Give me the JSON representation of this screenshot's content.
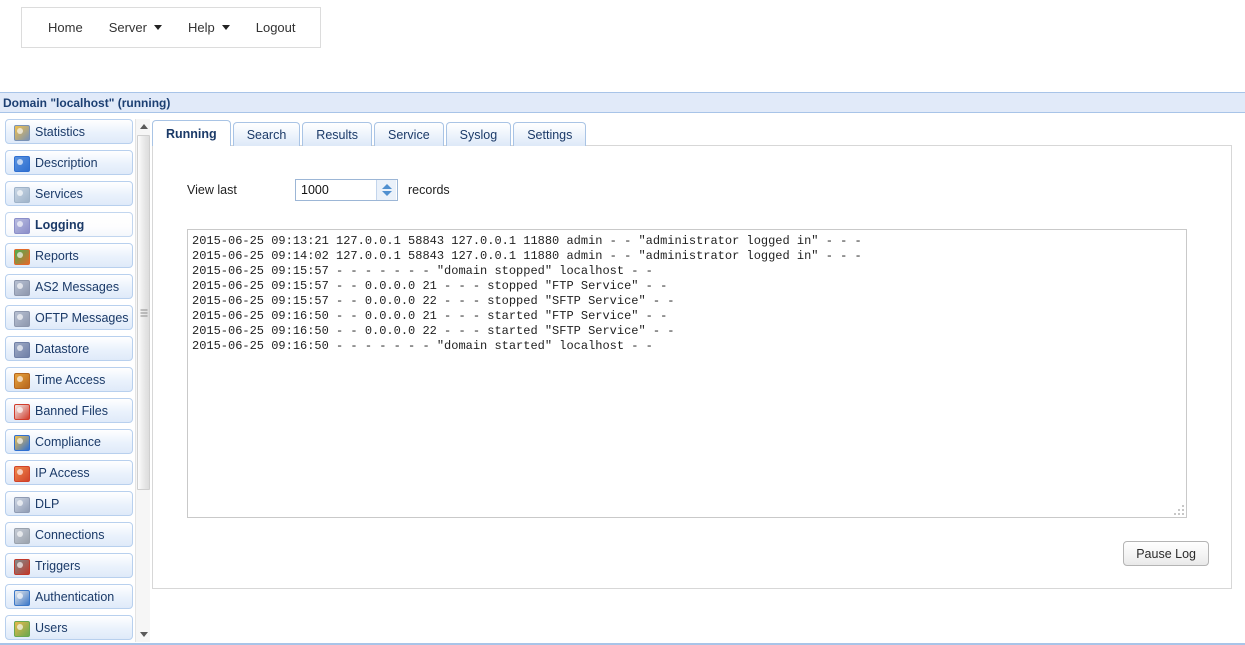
{
  "topnav": {
    "items": [
      {
        "label": "Home",
        "icon": "",
        "has_caret": false
      },
      {
        "label": "Server",
        "icon": "chevron-down-icon",
        "has_caret": true
      },
      {
        "label": "Help",
        "icon": "chevron-down-icon",
        "has_caret": true
      },
      {
        "label": "Logout",
        "icon": "",
        "has_caret": false
      }
    ]
  },
  "domain_bar": {
    "title": "Domain \"localhost\" (running)"
  },
  "sidebar": {
    "scrollbar": {
      "up_icon": "triangle-up-icon",
      "down_icon": "triangle-down-icon",
      "grip_icon": "grip-lines-icon"
    },
    "items": [
      {
        "label": "Statistics",
        "icon": "statistics-icon",
        "active": false,
        "c1": "#7a92b5",
        "c2": "#f2c14b"
      },
      {
        "label": "Description",
        "icon": "description-icon",
        "active": false,
        "c1": "#2f6fd0",
        "c2": "#5a93e0"
      },
      {
        "label": "Services",
        "icon": "services-icon",
        "active": false,
        "c1": "#9fb3c9",
        "c2": "#c8d6e5"
      },
      {
        "label": "Logging",
        "icon": "logging-icon",
        "active": true,
        "c1": "#8b8ec9",
        "c2": "#b9bce0"
      },
      {
        "label": "Reports",
        "icon": "reports-icon",
        "active": false,
        "c1": "#e06a2a",
        "c2": "#4caf50"
      },
      {
        "label": "AS2 Messages",
        "icon": "as2-messages-icon",
        "active": false,
        "c1": "#8d97ad",
        "c2": "#b7c0d2"
      },
      {
        "label": "OFTP Messages",
        "icon": "oftp-messages-icon",
        "active": false,
        "c1": "#8d97ad",
        "c2": "#b7c0d2"
      },
      {
        "label": "Datastore",
        "icon": "datastore-icon",
        "active": false,
        "c1": "#6f7fa6",
        "c2": "#9fabc6"
      },
      {
        "label": "Time Access",
        "icon": "time-access-icon",
        "active": false,
        "c1": "#b5651d",
        "c2": "#e8a33d"
      },
      {
        "label": "Banned Files",
        "icon": "banned-files-icon",
        "active": false,
        "c1": "#d13b2a",
        "c2": "#f0f0f0"
      },
      {
        "label": "Compliance",
        "icon": "compliance-icon",
        "active": false,
        "c1": "#2f6fd0",
        "c2": "#f2c14b"
      },
      {
        "label": "IP Access",
        "icon": "ip-access-icon",
        "active": false,
        "c1": "#d1432a",
        "c2": "#f08a4b"
      },
      {
        "label": "DLP",
        "icon": "dlp-icon",
        "active": false,
        "c1": "#8f9bb3",
        "c2": "#cdd6e4"
      },
      {
        "label": "Connections",
        "icon": "connections-icon",
        "active": false,
        "c1": "#9aa2ad",
        "c2": "#c6ccd6"
      },
      {
        "label": "Triggers",
        "icon": "triggers-icon",
        "active": false,
        "c1": "#c0392b",
        "c2": "#7f8c8d"
      },
      {
        "label": "Authentication",
        "icon": "authentication-icon",
        "active": false,
        "c1": "#3c78c8",
        "c2": "#e8e8e8"
      },
      {
        "label": "Users",
        "icon": "users-icon",
        "active": false,
        "c1": "#6aa84f",
        "c2": "#e8b84b"
      }
    ]
  },
  "main": {
    "tabs": [
      {
        "label": "Running",
        "active": true
      },
      {
        "label": "Search",
        "active": false
      },
      {
        "label": "Results",
        "active": false
      },
      {
        "label": "Service",
        "active": false
      },
      {
        "label": "Syslog",
        "active": false
      },
      {
        "label": "Settings",
        "active": false
      }
    ],
    "view_last": {
      "label": "View last",
      "value": "1000",
      "placeholder": "",
      "suffix_label": "records",
      "spinner_up_icon": "spinner-up-icon",
      "spinner_down_icon": "spinner-down-icon"
    },
    "log": {
      "resize_grip_icon": "resize-grip-icon",
      "lines": [
        "2015-06-25 09:13:21 127.0.0.1 58843 127.0.0.1 11880 admin - - \"administrator logged in\" - - -",
        "2015-06-25 09:14:02 127.0.0.1 58843 127.0.0.1 11880 admin - - \"administrator logged in\" - - -",
        "2015-06-25 09:15:57 - - - - - - - \"domain stopped\" localhost - -",
        "2015-06-25 09:15:57 - - 0.0.0.0 21 - - - stopped \"FTP Service\" - -",
        "2015-06-25 09:15:57 - - 0.0.0.0 22 - - - stopped \"SFTP Service\" - -",
        "2015-06-25 09:16:50 - - 0.0.0.0 21 - - - started \"FTP Service\" - -",
        "2015-06-25 09:16:50 - - 0.0.0.0 22 - - - started \"SFTP Service\" - -",
        "2015-06-25 09:16:50 - - - - - - - \"domain started\" localhost - -"
      ]
    },
    "pause_button": {
      "label": "Pause Log"
    }
  },
  "colors": {
    "accent_blue": "#a8c4e8",
    "title_bar_bg": "#e1eaf9",
    "title_text": "#1c3f72",
    "sidebar_item_text": "#1b3a68",
    "spinner_arrow": "#4f8fd0"
  }
}
